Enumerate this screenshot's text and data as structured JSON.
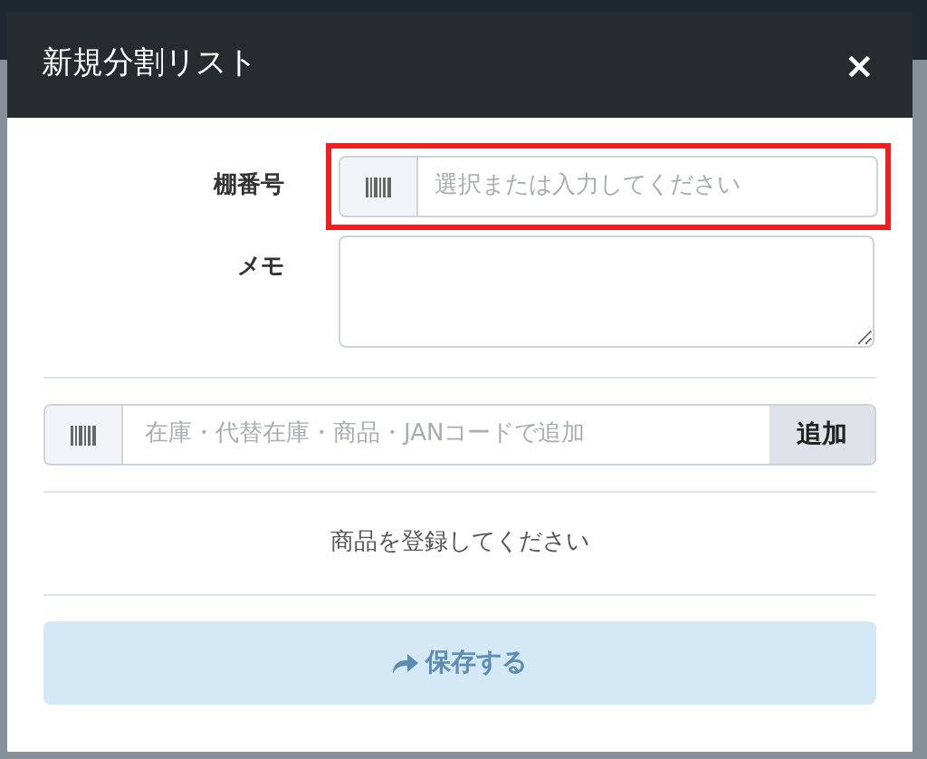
{
  "dialog": {
    "title": "新規分割リスト",
    "close": "×"
  },
  "shelf_field": {
    "label": "棚番号",
    "placeholder": "選択または入力してください",
    "highlighted": true
  },
  "memo_field": {
    "label": "メモ"
  },
  "add_field": {
    "placeholder": "在庫・代替在庫・商品・JANコードで追加",
    "button": "追加"
  },
  "empty_message": "商品を登録してください",
  "save_button": {
    "label": "保存する",
    "disabled": true
  }
}
